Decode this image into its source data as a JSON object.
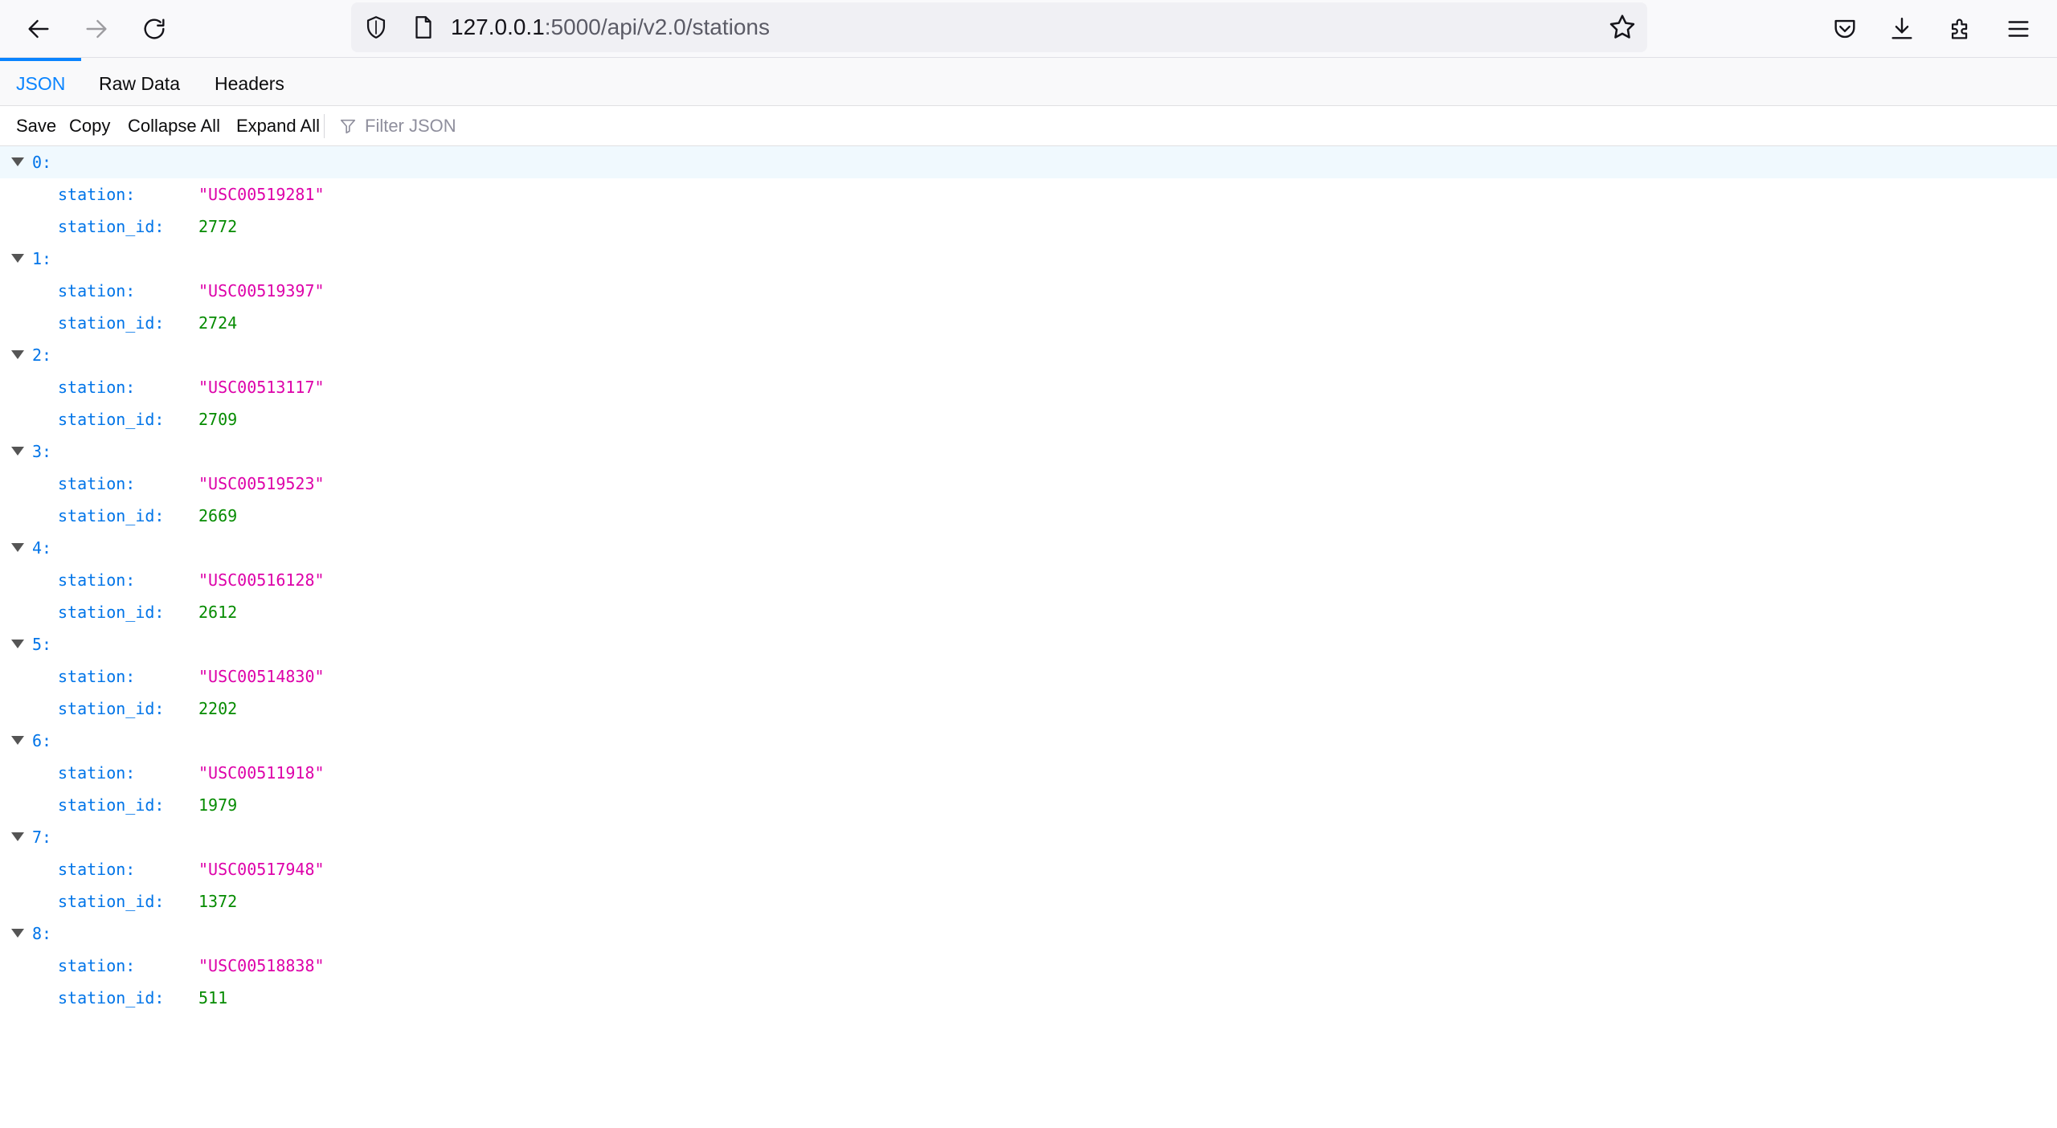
{
  "browser": {
    "url_host": "127.0.0.1",
    "url_rest": ":5000/api/v2.0/stations"
  },
  "viewer": {
    "tabs": [
      {
        "label": "JSON",
        "selected": true
      },
      {
        "label": "Raw Data",
        "selected": false
      },
      {
        "label": "Headers",
        "selected": false
      }
    ],
    "toolbar": {
      "save": "Save",
      "copy": "Copy",
      "collapse_all": "Collapse All",
      "expand_all": "Expand All",
      "filter_placeholder": "Filter JSON"
    }
  },
  "json": {
    "key_station": "station:",
    "key_station_id": "station_id:",
    "items": [
      {
        "index": "0:",
        "station": "\"USC00519281\"",
        "station_id": "2772"
      },
      {
        "index": "1:",
        "station": "\"USC00519397\"",
        "station_id": "2724"
      },
      {
        "index": "2:",
        "station": "\"USC00513117\"",
        "station_id": "2709"
      },
      {
        "index": "3:",
        "station": "\"USC00519523\"",
        "station_id": "2669"
      },
      {
        "index": "4:",
        "station": "\"USC00516128\"",
        "station_id": "2612"
      },
      {
        "index": "5:",
        "station": "\"USC00514830\"",
        "station_id": "2202"
      },
      {
        "index": "6:",
        "station": "\"USC00511918\"",
        "station_id": "1979"
      },
      {
        "index": "7:",
        "station": "\"USC00517948\"",
        "station_id": "1372"
      },
      {
        "index": "8:",
        "station": "\"USC00518838\"",
        "station_id": "511"
      }
    ]
  },
  "colors": {
    "key": "#0074e8",
    "string": "#dd00a9",
    "number": "#058b00",
    "accent": "#0a84ff"
  }
}
